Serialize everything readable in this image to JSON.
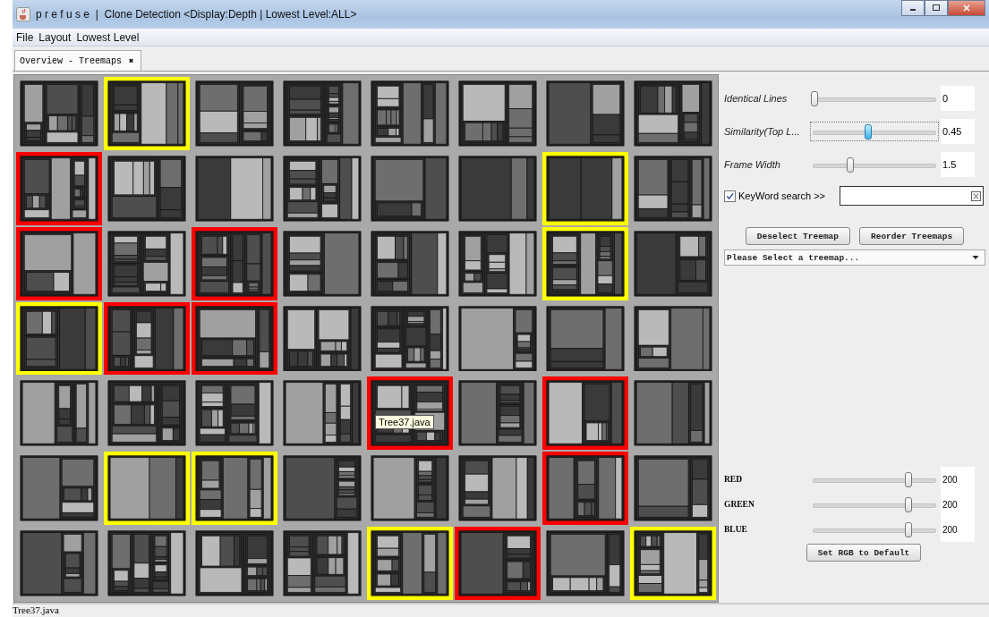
{
  "window": {
    "title": "p r e f u s e  |  Clone Detection <Display:Depth | Lowest Level:ALL>"
  },
  "menu": [
    "File",
    "Layout",
    "Lowest Level"
  ],
  "tabs": [
    {
      "label": "Overview - Treemaps",
      "selected": true,
      "close": "✖"
    }
  ],
  "tiles": [
    {
      "highlighted": false
    },
    {
      "highlighted": true,
      "color": "#ffff00"
    },
    {
      "highlighted": false
    },
    {
      "highlighted": false
    },
    {
      "highlighted": false
    },
    {
      "highlighted": false
    },
    {
      "highlighted": false
    },
    {
      "highlighted": false
    },
    {
      "highlighted": true,
      "color": "#ff0000"
    },
    {
      "highlighted": false
    },
    {
      "highlighted": false
    },
    {
      "highlighted": false
    },
    {
      "highlighted": false
    },
    {
      "highlighted": false
    },
    {
      "highlighted": true,
      "color": "#ffff00"
    },
    {
      "highlighted": false
    },
    {
      "highlighted": true,
      "color": "#ff0000"
    },
    {
      "highlighted": false
    },
    {
      "highlighted": true,
      "color": "#ff0000"
    },
    {
      "highlighted": false
    },
    {
      "highlighted": false
    },
    {
      "highlighted": false
    },
    {
      "highlighted": true,
      "color": "#ffff00"
    },
    {
      "highlighted": false
    },
    {
      "highlighted": true,
      "color": "#ffff00"
    },
    {
      "highlighted": true,
      "color": "#ff0000"
    },
    {
      "highlighted": true,
      "color": "#ff0000"
    },
    {
      "highlighted": false
    },
    {
      "highlighted": false
    },
    {
      "highlighted": false
    },
    {
      "highlighted": false
    },
    {
      "highlighted": false
    },
    {
      "highlighted": false
    },
    {
      "highlighted": false
    },
    {
      "highlighted": false
    },
    {
      "highlighted": false
    },
    {
      "highlighted": true,
      "color": "#ff0000",
      "tooltip": "Tree37.java"
    },
    {
      "highlighted": false
    },
    {
      "highlighted": true,
      "color": "#ff0000"
    },
    {
      "highlighted": false
    },
    {
      "highlighted": false
    },
    {
      "highlighted": true,
      "color": "#ffff00"
    },
    {
      "highlighted": true,
      "color": "#ffff00"
    },
    {
      "highlighted": false
    },
    {
      "highlighted": false
    },
    {
      "highlighted": false
    },
    {
      "highlighted": true,
      "color": "#ff0000"
    },
    {
      "highlighted": false
    },
    {
      "highlighted": false
    },
    {
      "highlighted": false
    },
    {
      "highlighted": false
    },
    {
      "highlighted": false
    },
    {
      "highlighted": true,
      "color": "#ffff00"
    },
    {
      "highlighted": true,
      "color": "#ff0000"
    },
    {
      "highlighted": false
    },
    {
      "highlighted": true,
      "color": "#ffff00"
    }
  ],
  "sliders": [
    {
      "label": "Identical Lines",
      "level": 0,
      "value": "0",
      "focused": false
    },
    {
      "label": "Similarity(Top L...",
      "level": 0.45,
      "value": "0.45",
      "focused": true
    },
    {
      "label": "Frame Width",
      "level": 0.3,
      "value": "1.5",
      "focused": false
    }
  ],
  "keyword": {
    "checked": true,
    "label": "KeyWord search >>"
  },
  "buttons": [
    "Deselect Treemap",
    "Reorder Treemaps"
  ],
  "dropdown": {
    "value": "Please Select a treemap..."
  },
  "rgb_sliders": [
    {
      "label": "RED",
      "level": 0.78,
      "value": "200"
    },
    {
      "label": "GREEN",
      "level": 0.78,
      "value": "200"
    },
    {
      "label": "BLUE",
      "level": 0.78,
      "value": "200"
    }
  ],
  "reset_button": "Set RGB to Default",
  "status_bar": "Tree37.java"
}
